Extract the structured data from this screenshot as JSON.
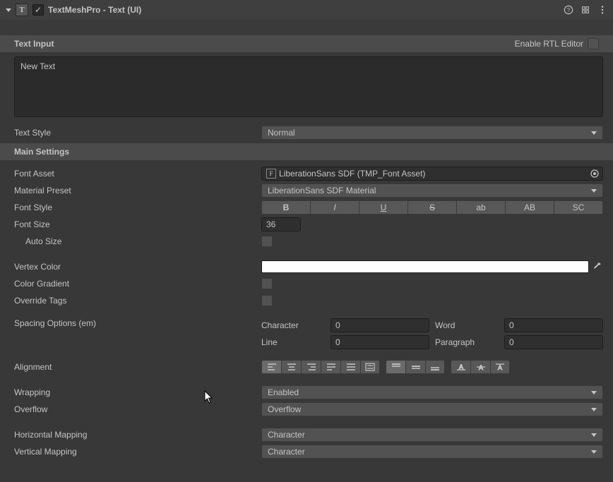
{
  "header": {
    "title": "TextMeshPro - Text (UI)",
    "enabled": true
  },
  "textInput": {
    "section_label": "Text Input",
    "rtl_label": "Enable RTL Editor",
    "rtl_enabled": false,
    "value": "New Text"
  },
  "textStyle": {
    "label": "Text Style",
    "value": "Normal"
  },
  "mainSettings": {
    "section_label": "Main Settings",
    "fontAsset": {
      "label": "Font Asset",
      "value": "LiberationSans SDF (TMP_Font Asset)"
    },
    "materialPreset": {
      "label": "Material Preset",
      "value": "LiberationSans SDF Material"
    },
    "fontStyle": {
      "label": "Font Style",
      "buttons": [
        "B",
        "I",
        "U",
        "S",
        "ab",
        "AB",
        "SC"
      ]
    },
    "fontSize": {
      "label": "Font Size",
      "value": "36"
    },
    "autoSize": {
      "label": "Auto Size"
    },
    "vertexColor": {
      "label": "Vertex Color",
      "value": "#ffffff"
    },
    "colorGradient": {
      "label": "Color Gradient"
    },
    "overrideTags": {
      "label": "Override Tags"
    },
    "spacing": {
      "label": "Spacing Options (em)",
      "character": {
        "label": "Character",
        "value": "0"
      },
      "word": {
        "label": "Word",
        "value": "0"
      },
      "line": {
        "label": "Line",
        "value": "0"
      },
      "paragraph": {
        "label": "Paragraph",
        "value": "0"
      }
    },
    "alignment": {
      "label": "Alignment"
    },
    "wrapping": {
      "label": "Wrapping",
      "value": "Enabled"
    },
    "overflow": {
      "label": "Overflow",
      "value": "Overflow"
    },
    "horizontalMapping": {
      "label": "Horizontal Mapping",
      "value": "Character"
    },
    "verticalMapping": {
      "label": "Vertical Mapping",
      "value": "Character"
    }
  }
}
